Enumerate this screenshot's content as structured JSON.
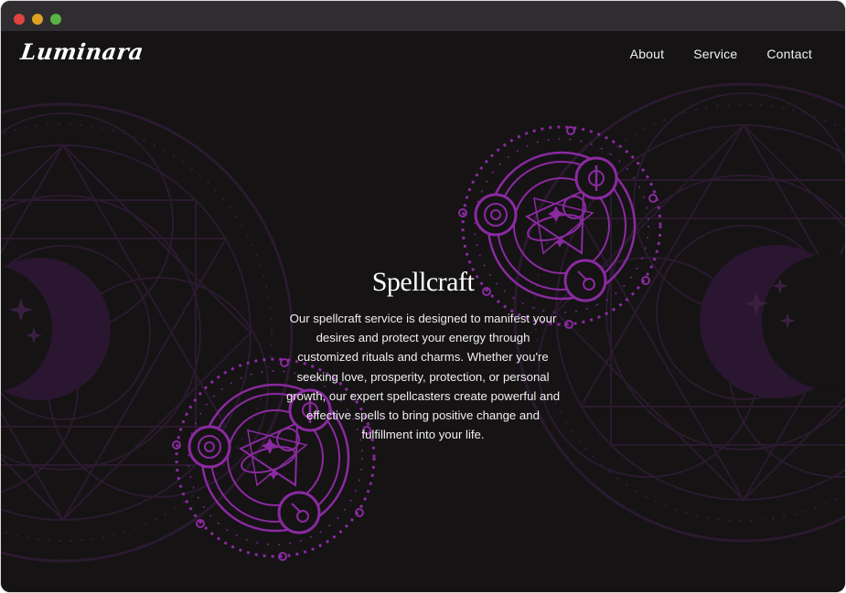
{
  "site": {
    "logo": "Luminara"
  },
  "nav": {
    "items": [
      {
        "label": "About"
      },
      {
        "label": "Service"
      },
      {
        "label": "Contact"
      }
    ]
  },
  "hero": {
    "title": "Spellcraft",
    "description": "Our spellcraft service is designed to manifest your desires and protect your energy through customized rituals and charms. Whether you're seeking love, prosperity, protection, or personal growth, our expert spellcasters create powerful and effective spells to bring positive change and fulfillment into your life."
  },
  "colors": {
    "background": "#151314",
    "titlebar": "#2f2d2f",
    "accent_purple": "#8a2aa0",
    "faint_purple": "#3a2040",
    "text": "#ffffff"
  },
  "icons": {
    "window_close": "red-dot",
    "window_minimize": "yellow-dot",
    "window_maximize": "green-dot",
    "decor": "mystic-sigil"
  }
}
